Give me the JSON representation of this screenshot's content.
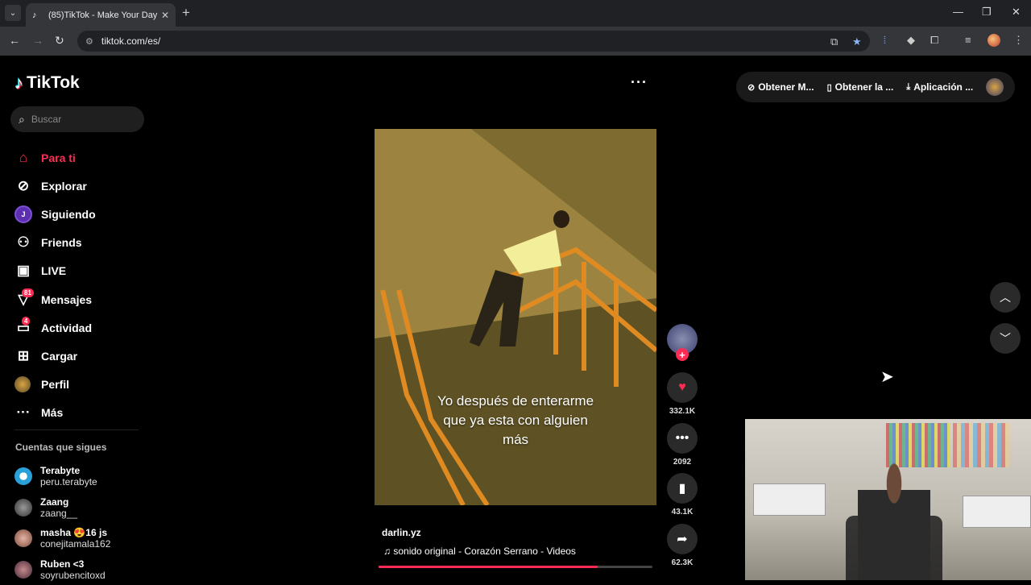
{
  "browser": {
    "tab_title": "(85)TikTok - Make Your Day",
    "tab_close": "✕",
    "new_tab": "+",
    "url": "tiktok.com/es/"
  },
  "brand": {
    "name": "TikTok"
  },
  "search": {
    "placeholder": "Buscar"
  },
  "nav": [
    {
      "label": "Para ti",
      "icon": "home-icon"
    },
    {
      "label": "Explorar",
      "icon": "compass-icon"
    },
    {
      "label": "Siguiendo",
      "icon": "following-avatar",
      "avatar_letter": "J"
    },
    {
      "label": "Friends",
      "icon": "friends-icon"
    },
    {
      "label": "LIVE",
      "icon": "live-tv-icon"
    },
    {
      "label": "Mensajes",
      "icon": "messages-icon",
      "badge": "81"
    },
    {
      "label": "Actividad",
      "icon": "activity-icon",
      "badge": "4"
    },
    {
      "label": "Cargar",
      "icon": "upload-plus-icon"
    },
    {
      "label": "Perfil",
      "icon": "profile-avatar"
    },
    {
      "label": "Más",
      "icon": "more-dots-icon"
    }
  ],
  "following_section": {
    "title": "Cuentas que sigues",
    "accounts": [
      {
        "name": "Terabyte",
        "handle": "peru.terabyte"
      },
      {
        "name": "Zaang",
        "handle": "zaang__"
      },
      {
        "name": "masha 😍16 js",
        "handle": "conejitamala162"
      },
      {
        "name": "Ruben <3",
        "handle": "soyrubencitoxd"
      }
    ]
  },
  "topbar": {
    "items": [
      "Obtener M...",
      "Obtener la ...",
      "Aplicación ..."
    ]
  },
  "video": {
    "caption_lines": [
      "Yo después de enterarme",
      "que ya esta con alguien",
      "más"
    ],
    "author": "darlin.yz",
    "sound": "sonido original - Corazón Serrano - Videos",
    "progress_fraction": 0.8
  },
  "actions": {
    "likes": "332.1K",
    "comments": "2092",
    "saves": "43.1K",
    "shares": "62.3K"
  },
  "colors": {
    "accent": "#fe2c55",
    "background": "#000000"
  }
}
